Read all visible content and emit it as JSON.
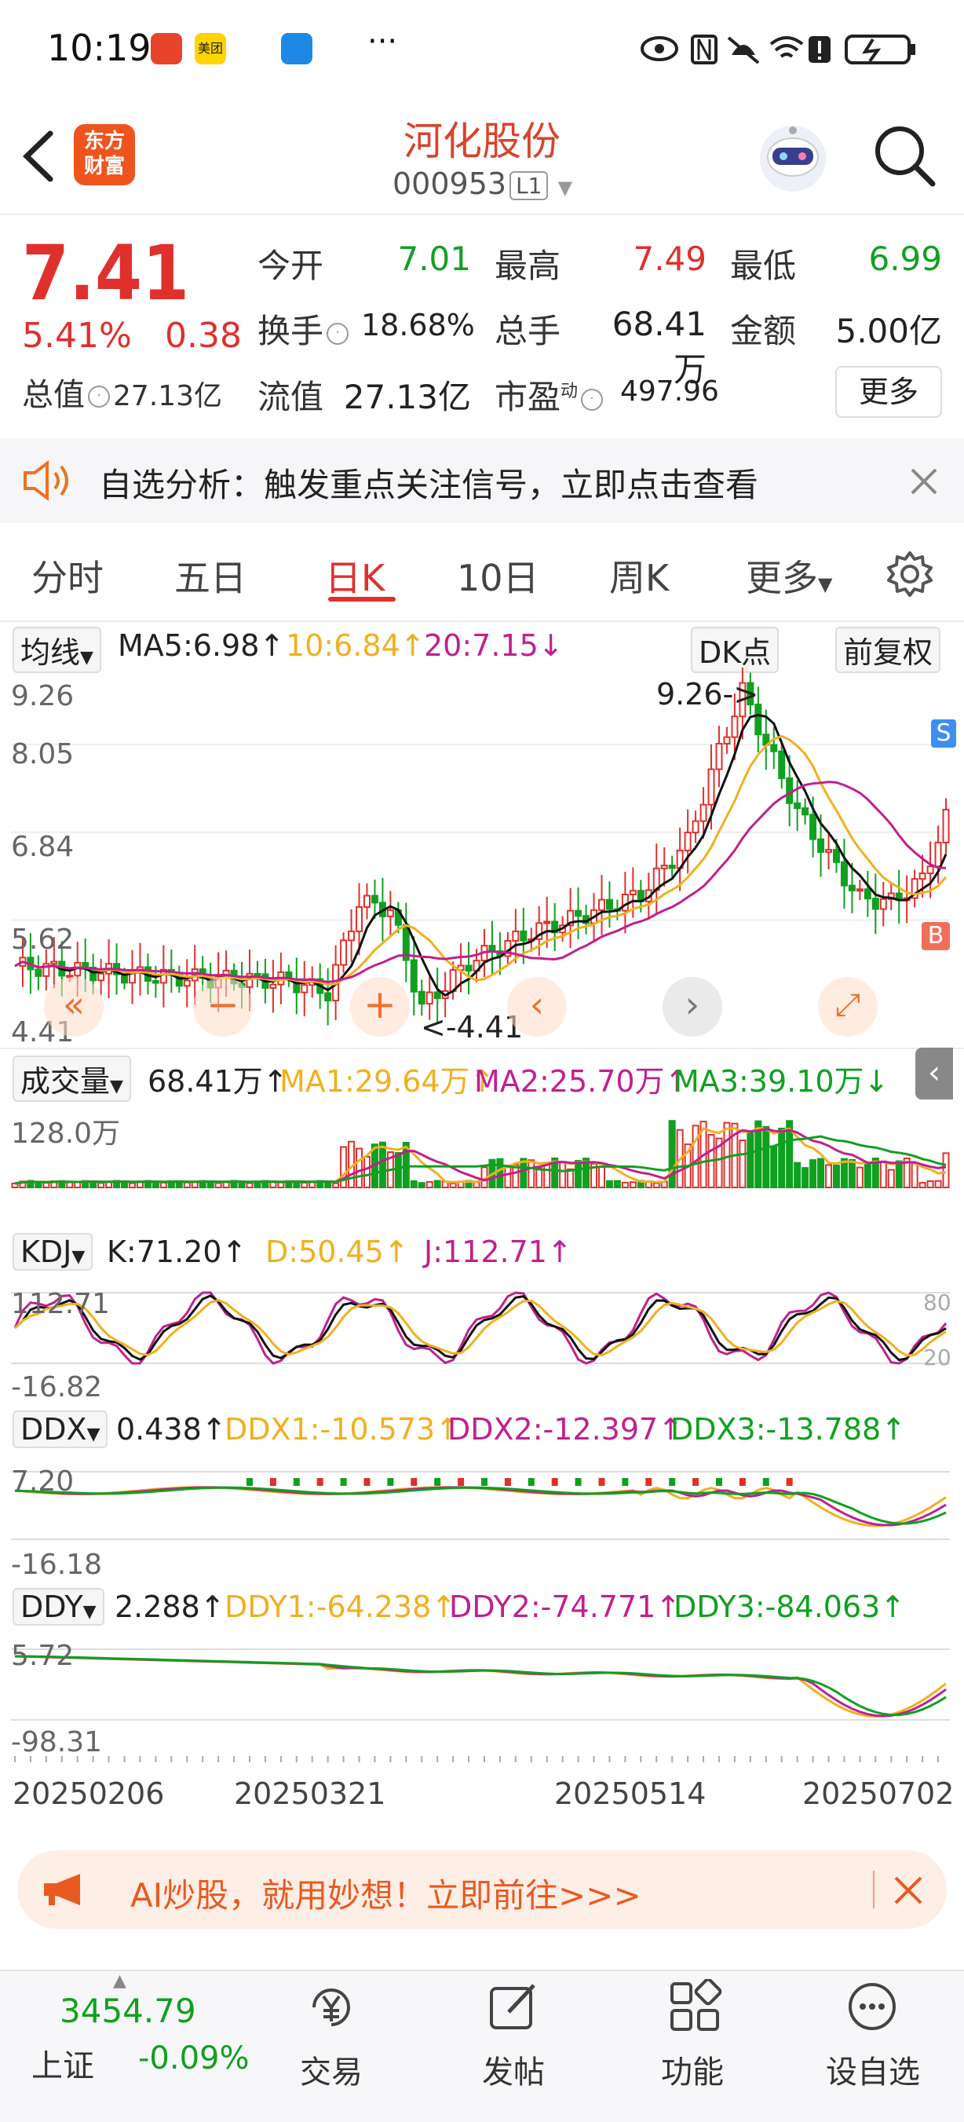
{
  "status_bar": {
    "time": "10:19",
    "dots": "···",
    "meituan": "美团"
  },
  "header": {
    "brand_line1": "东方",
    "brand_line2": "财富",
    "title": "河化股份",
    "code": "000953",
    "level": "L1"
  },
  "quote": {
    "price": "7.41",
    "change_pct": "5.41%",
    "change_amt": "0.38",
    "open_label": "今开",
    "open": "7.01",
    "high_label": "最高",
    "high": "7.49",
    "low_label": "最低",
    "low": "6.99",
    "turnover_label": "换手",
    "turnover": "18.68%",
    "volume_label": "总手",
    "volume": "68.41万",
    "amount_label": "金额",
    "amount": "5.00亿",
    "mcap_label": "总值",
    "mcap": "27.13亿",
    "float_label": "流值",
    "float_val": "27.13亿",
    "pe_label": "市盈",
    "pe_sup": "动",
    "pe": "497.96",
    "more_button": "更多"
  },
  "notice": {
    "text": "自选分析：触发重点关注信号，立即点击查看"
  },
  "tabs": [
    {
      "label": "分时"
    },
    {
      "label": "五日"
    },
    {
      "label": "日K"
    },
    {
      "label": "10日"
    },
    {
      "label": "周K"
    },
    {
      "label": "更多"
    }
  ],
  "ma_row": {
    "selector": "均线",
    "ma5": "MA5:6.98↑",
    "ma10": "10:6.84↑",
    "ma20": "20:7.15↓",
    "dk": "DK点",
    "adjust": "前复权"
  },
  "kline": {
    "y_top": "9.26",
    "y_2": "8.05",
    "y_3": "6.84",
    "y_4": "5.62",
    "y_bottom": "4.41",
    "high_marker": "9.26->",
    "low_marker": "<-4.41",
    "sell_tag": "S",
    "buy_tag": "B"
  },
  "volume": {
    "selector": "成交量",
    "value": "68.41万↑",
    "ma1": "MA1:29.64万↑",
    "ma2": "MA2:25.70万↑",
    "ma3": "MA3:39.10万↓",
    "y_top": "128.0万"
  },
  "kdj": {
    "selector": "KDJ",
    "k": "K:71.20↑",
    "d": "D:50.45↑",
    "j": "J:112.71↑",
    "y_top": "112.71",
    "y_bottom": "-16.82",
    "r80": "80",
    "r20": "20"
  },
  "ddx": {
    "selector": "DDX",
    "value": "0.438↑",
    "ddx1": "DDX1:-10.573↑",
    "ddx2": "DDX2:-12.397↑",
    "ddx3": "DDX3:-13.788↑",
    "y_top": "7.20",
    "y_bottom": "-16.18"
  },
  "ddy": {
    "selector": "DDY",
    "value": "2.288↑",
    "ddy1": "DDY1:-64.238↑",
    "ddy2": "DDY2:-74.771↑",
    "ddy3": "DDY3:-84.063↑",
    "y_top": "5.72",
    "y_bottom": "-98.31"
  },
  "dates": [
    "20250206",
    "20250321",
    "20250514",
    "20250702"
  ],
  "ad_banner": {
    "text": "AI炒股，就用妙想！立即前往>>>"
  },
  "bottom_nav": {
    "index_value": "3454.79",
    "index_name": "上证",
    "index_change": "-0.09%",
    "items": [
      {
        "label": "交易"
      },
      {
        "label": "发帖"
      },
      {
        "label": "功能"
      },
      {
        "label": "设自选"
      }
    ]
  },
  "colors": {
    "up": "#e0302c",
    "down": "#10a020",
    "ma5": "#111111",
    "ma10": "#f0b020",
    "ma20": "#c0208f"
  }
}
